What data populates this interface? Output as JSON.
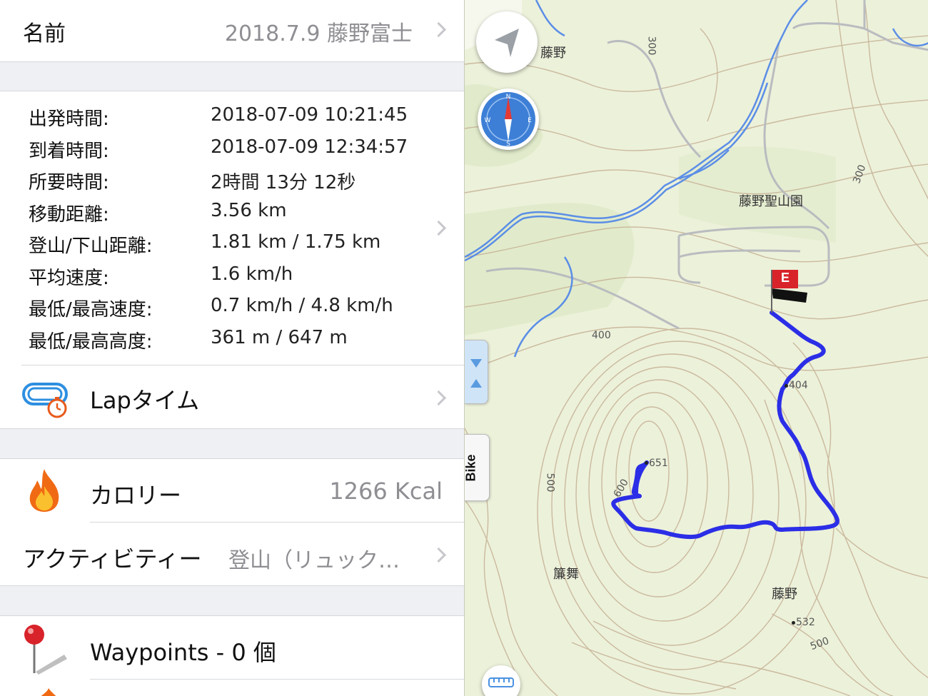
{
  "name_row": {
    "label": "名前",
    "value": "2018.7.9 藤野富士"
  },
  "stats": [
    {
      "key": "出発時間:",
      "value": "2018-07-09 10:21:45"
    },
    {
      "key": "到着時間:",
      "value": "2018-07-09 12:34:57"
    },
    {
      "key": "所要時間:",
      "value": "2時間 13分 12秒"
    },
    {
      "key": "移動距離:",
      "value": "3.56 km"
    },
    {
      "key": "登山/下山距離:",
      "value": "1.81 km / 1.75 km"
    },
    {
      "key": "平均速度:",
      "value": "1.6 km/h"
    },
    {
      "key": "最低/最高速度:",
      "value": "0.7 km/h / 4.8 km/h"
    },
    {
      "key": "最低/最高高度:",
      "value": "361 m / 647 m"
    }
  ],
  "lap": {
    "label": "Lapタイム"
  },
  "calorie": {
    "label": "カロリー",
    "value": "1266 Kcal"
  },
  "activity": {
    "label": "アクティビティー",
    "value": "登山（リュック…"
  },
  "waypoints": {
    "label": "Waypoints - 0 個"
  },
  "map": {
    "labels": {
      "fujino_top": "藤野",
      "seizan": "藤野聖山園",
      "misu": "簾舞",
      "fujino_bottom": "藤野"
    },
    "contours": {
      "c300a": "300",
      "c300b": "300",
      "c400": "400",
      "c500a": "500",
      "c500b": "500",
      "c600": "600"
    },
    "spots": {
      "p404": "404",
      "p651": "651",
      "p532": "532"
    },
    "flag_letter": "E",
    "bike_tab": "Bike",
    "track_color": "#2b2ee6"
  }
}
